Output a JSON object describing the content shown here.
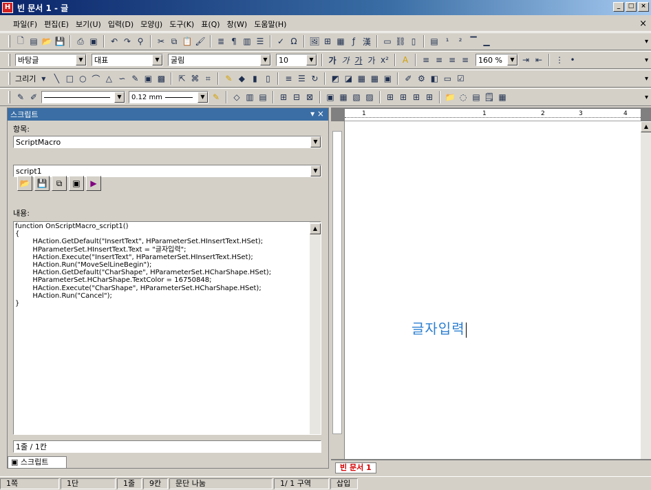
{
  "window": {
    "title": "빈 문서 1 - 글",
    "icon": "hwp-app-icon",
    "accent": "#0a246a"
  },
  "menu": [
    "파일(F)",
    "편집(E)",
    "보기(U)",
    "입력(D)",
    "모양(J)",
    "도구(K)",
    "표(Q)",
    "창(W)",
    "도움말(H)"
  ],
  "format": {
    "style": "바탕글",
    "font_lang": "대표",
    "font": "굴림",
    "size": "10",
    "line_spacing": "160 %"
  },
  "draw": {
    "menu_label": "그리기",
    "line_width": "0.12 mm"
  },
  "pane": {
    "title": "스크립트",
    "item_label": "항목:",
    "item_value": "ScriptMacro",
    "script_value": "script1",
    "content_label": "내용:",
    "code": "function OnScriptMacro_script1()\n{\n        HAction.GetDefault(\"InsertText\", HParameterSet.HInsertText.HSet);\n        HParameterSet.HInsertText.Text = \"글자입력\";\n        HAction.Execute(\"InsertText\", HParameterSet.HInsertText.HSet);\n        HAction.Run(\"MoveSelLineBegin\");\n        HAction.GetDefault(\"CharShape\", HParameterSet.HCharShape.HSet);\n        HParameterSet.HCharShape.TextColor = 16750848;\n        HAction.Execute(\"CharShape\", HParameterSet.HCharShape.HSet);\n        HAction.Run(\"Cancel\");\n}",
    "line_col": "1줄 / 1칸",
    "tab_label": "스크립트"
  },
  "document": {
    "text": "글자입력",
    "text_color": "#2c7fd1",
    "tab_label": "빈 문서 1",
    "ruler_numbers": [
      "1",
      "1",
      "2",
      "3",
      "4"
    ]
  },
  "status": {
    "page": "1쪽",
    "section": "1단",
    "line": "1줄",
    "col": "9칸",
    "break": "문단 나눔",
    "page_of": "1/ 1 구역",
    "mode": "삽입"
  }
}
